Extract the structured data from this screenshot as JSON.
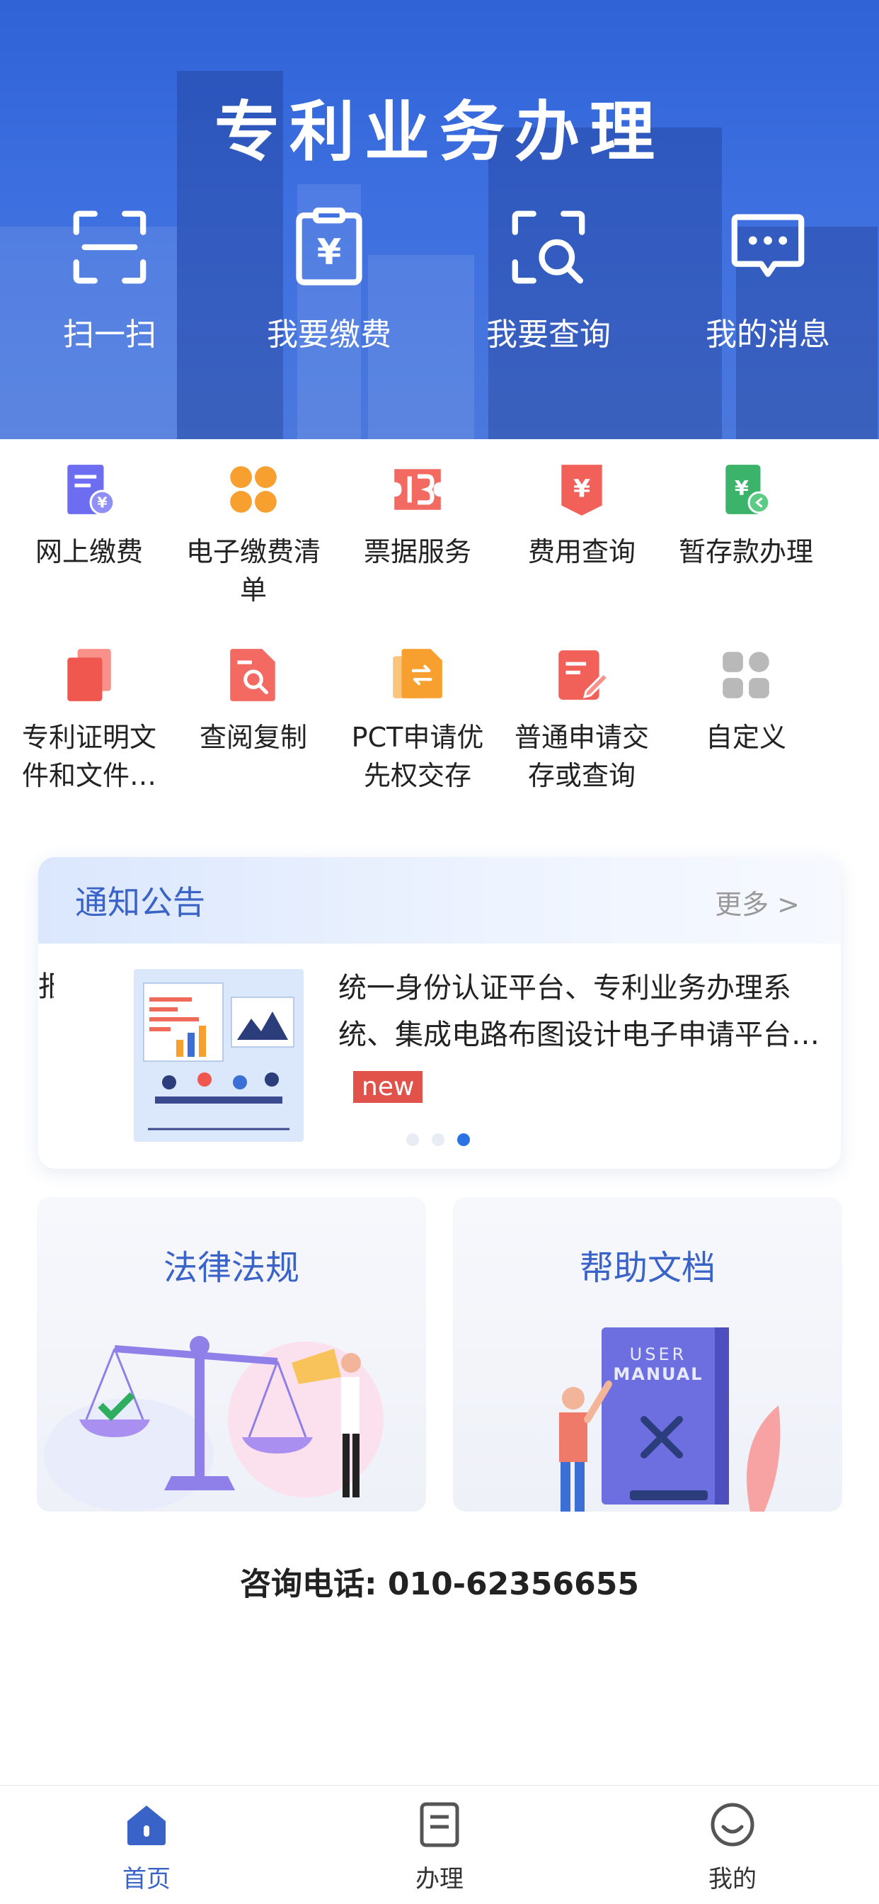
{
  "hero": {
    "title": "专利业务办理",
    "actions": [
      {
        "label": "扫一扫",
        "icon": "scan-icon"
      },
      {
        "label": "我要缴费",
        "icon": "payment-clipboard-icon"
      },
      {
        "label": "我要查询",
        "icon": "search-query-icon"
      },
      {
        "label": "我的消息",
        "icon": "message-bubble-icon"
      }
    ]
  },
  "services": [
    {
      "label": "网上缴费",
      "icon": "online-payment-icon",
      "color": "#6c6df0"
    },
    {
      "label": "电子缴费清单",
      "icon": "clover-list-icon",
      "color": "#f7a030"
    },
    {
      "label": "票据服务",
      "icon": "ticket-icon",
      "color": "#f26a62"
    },
    {
      "label": "费用查询",
      "icon": "fee-query-icon",
      "color": "#f2605a"
    },
    {
      "label": "暂存款办理",
      "icon": "deposit-icon",
      "color": "#3bb36a"
    },
    {
      "label": "专利证明文件和文件…",
      "icon": "documents-icon",
      "color": "#f0574f"
    },
    {
      "label": "查阅复制",
      "icon": "file-search-icon",
      "color": "#f26a62"
    },
    {
      "label": "PCT申请优先权交存",
      "icon": "file-exchange-icon",
      "color": "#f7a030"
    },
    {
      "label": "普通申请交存或查询",
      "icon": "edit-document-icon",
      "color": "#f2605a"
    },
    {
      "label": "自定义",
      "icon": "grid-custom-icon",
      "color": "#b9b9b9"
    }
  ],
  "notice": {
    "title": "通知公告",
    "more": "更多 >",
    "fragment": "报",
    "text": "统一身份认证平台、专利业务办理系统、集成电路布图设计电子申请平台…",
    "badge": "new"
  },
  "cards": {
    "law": "法律法规",
    "help": "帮助文档"
  },
  "contact": "咨询电话: 010-62356655",
  "tabs": [
    {
      "label": "首页",
      "icon": "home-icon",
      "active": true
    },
    {
      "label": "办理",
      "icon": "document-icon",
      "active": false
    },
    {
      "label": "我的",
      "icon": "smile-profile-icon",
      "active": false
    }
  ],
  "colors": {
    "brand": "#3a63c8",
    "hero": "#3d6fe0",
    "active_dot": "#2b73e4"
  }
}
